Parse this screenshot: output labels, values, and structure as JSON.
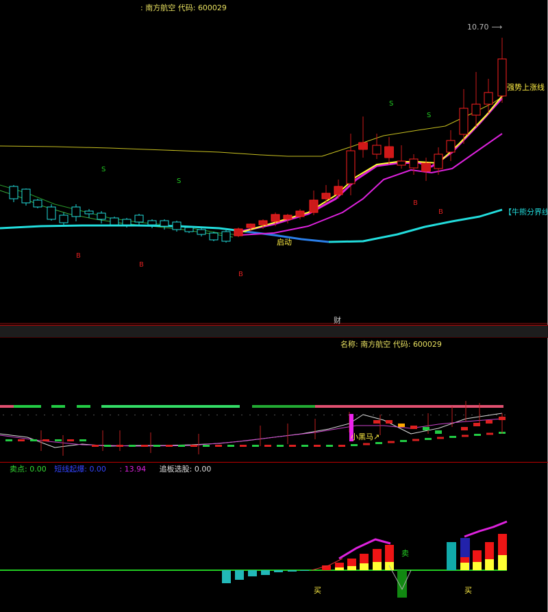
{
  "main_chart": {
    "title_prefix": ":",
    "stock_name": "南方航空",
    "code_label": "代码:",
    "stock_code": "600029",
    "price_marker": "10.70",
    "label_strong_trend": "强势上涨线",
    "label_bull_bear": "【牛熊分界线",
    "label_start": "启动",
    "label_cai": "财",
    "signals_s": [
      "S",
      "S",
      "S",
      "S"
    ],
    "signals_b": [
      "B",
      "B",
      "B",
      "B",
      "B"
    ]
  },
  "indicator_panel": {
    "name_label": "名称:",
    "stock_name": "南方航空",
    "code_label": "代码:",
    "stock_code": "600029",
    "label_dark_horse": "小黑马↗"
  },
  "bottom_panel": {
    "legend": [
      {
        "label": "卖点:",
        "value": "0.00",
        "color": "#33dd33"
      },
      {
        "label": "短线起爆:",
        "value": "0.00",
        "color": "#3344ff"
      },
      {
        "label": ":",
        "value": "13.94",
        "color": "#dd22dd"
      },
      {
        "label": "追板选股:",
        "value": "0.00",
        "color": "#dddddd"
      }
    ],
    "label_buy": "买",
    "label_sell": "卖"
  },
  "colors": {
    "up": "#ff2020",
    "down_body": "#22dddd",
    "ma_yellow": "#c8c020",
    "bull_line": "#22dddd",
    "magenta": "#dd22dd",
    "green": "#22cc22",
    "yellow": "#ffff33"
  }
}
